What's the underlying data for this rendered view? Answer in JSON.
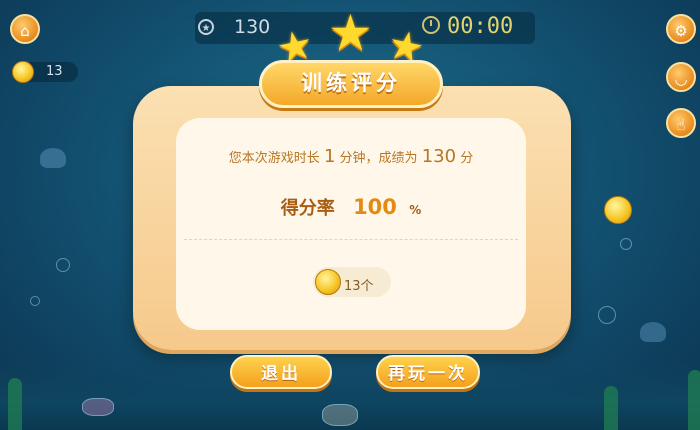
{
  "hud": {
    "score_icon": "star-circle-icon",
    "score": "130",
    "timer_icon": "stopwatch-icon",
    "timer": "00:00",
    "coins": "13"
  },
  "side_buttons": {
    "home": "home-icon",
    "settings": "gear-icon",
    "tool": "cup-icon",
    "hint": "hand-icon"
  },
  "dialog": {
    "title": "训练评分",
    "stars_earned": 3,
    "stars_total": 3,
    "result_prefix": "您本次游戏时长",
    "duration": "1",
    "duration_unit": "分钟，成绩为",
    "score": "130",
    "score_unit": "分",
    "rate_label": "得分率",
    "rate_value": "100",
    "rate_unit": "%",
    "reward_count": "13个"
  },
  "buttons": {
    "exit": "退出",
    "retry": "再玩一次"
  },
  "colors": {
    "accent": "#f3a01d",
    "text_brown": "#b77525",
    "water": "#124e6e"
  }
}
